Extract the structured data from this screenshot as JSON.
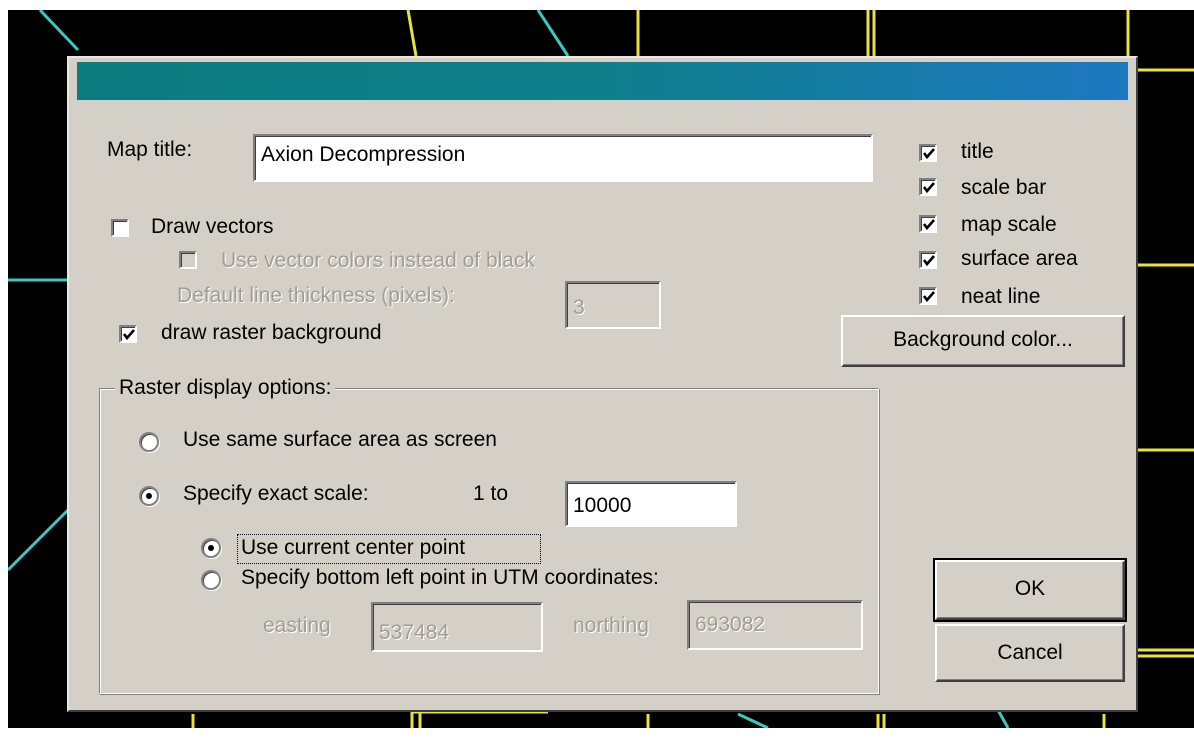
{
  "dialog": {
    "map_title_label": "Map title:",
    "map_title_value": "Axion Decompression",
    "draw_vectors": {
      "label": "Draw vectors",
      "checked": false
    },
    "use_vector_colors": {
      "label": "Use vector colors instead of black",
      "checked": false,
      "enabled": false
    },
    "line_thickness": {
      "label": "Default line thickness (pixels):",
      "value": "3",
      "enabled": false
    },
    "draw_raster_background": {
      "label": "draw raster background",
      "checked": true
    },
    "raster_options": {
      "group_title": "Raster display options:",
      "same_surface": {
        "label": "Use same surface area as screen",
        "selected": false
      },
      "exact_scale": {
        "label": "Specify exact scale:",
        "selected": true,
        "ratio_prefix": "1 to",
        "ratio_value": "10000"
      },
      "current_center": {
        "label": "Use current center point",
        "selected": true
      },
      "bottom_left": {
        "label": "Specify bottom left point in UTM coordinates:",
        "selected": false
      },
      "easting": {
        "label": "easting",
        "value": "537484"
      },
      "northing": {
        "label": "northing",
        "value": "693082"
      }
    },
    "map_elements": [
      {
        "label": "title",
        "checked": true
      },
      {
        "label": "scale bar",
        "checked": true
      },
      {
        "label": "map scale",
        "checked": true
      },
      {
        "label": "surface area",
        "checked": true
      },
      {
        "label": "neat line",
        "checked": true
      }
    ],
    "background_color_button": "Background color...",
    "ok_button": "OK",
    "cancel_button": "Cancel"
  },
  "colors": {
    "titlebar_start": "#0c7c80",
    "titlebar_end": "#1d78c0",
    "map_lines_yellow": "#e8e23a",
    "map_lines_cyan": "#39c9c0"
  }
}
